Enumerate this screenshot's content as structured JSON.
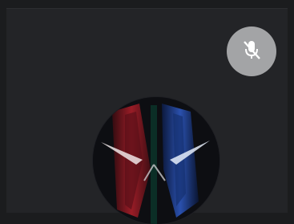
{
  "video_tile": {
    "status_icon": "microphone-muted-icon",
    "avatar_icon": "avatar",
    "colors": {
      "background": "#1b1c1e",
      "tile": "#232427",
      "badge": "#a3a4a6",
      "badge_glyph": "#ffffff",
      "avatar_red": "#b21f2a",
      "avatar_blue": "#2f5cc9"
    }
  }
}
